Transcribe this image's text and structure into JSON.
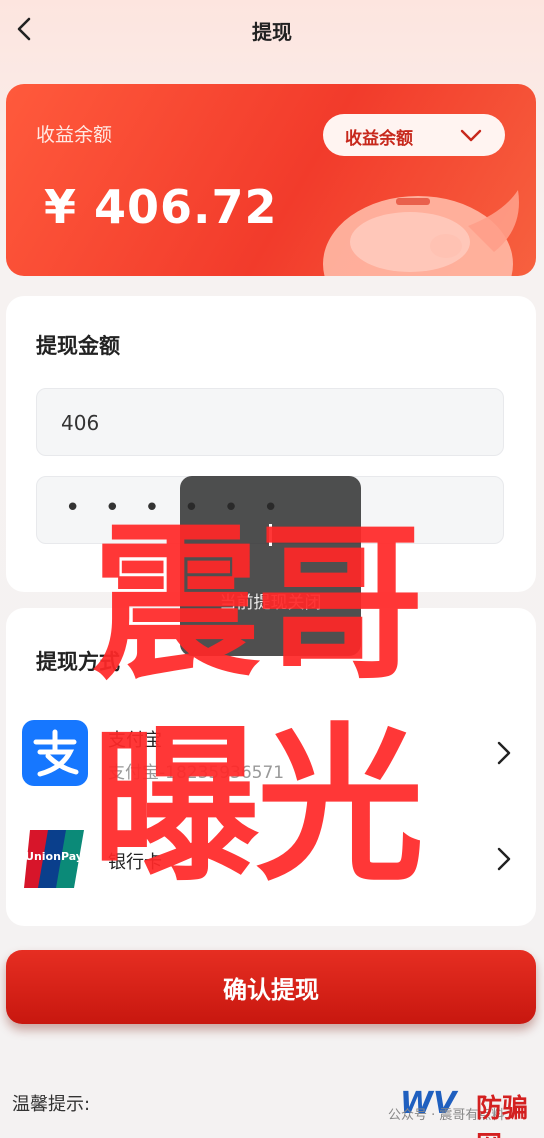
{
  "header": {
    "title": "提现"
  },
  "balance": {
    "label": "收益余额",
    "amount": "¥ 406.72",
    "selector_label": "收益余额"
  },
  "withdraw": {
    "section_title": "提现金额",
    "amount_value": "406",
    "password_dots": "• • • • • •"
  },
  "methods": {
    "section_title": "提现方式",
    "items": [
      {
        "name": "支付宝",
        "detail": "支付宝-18235936571"
      },
      {
        "name": "银行卡",
        "detail": ""
      }
    ]
  },
  "confirm_label": "确认提现",
  "tips_label": "温馨提示:",
  "toast": {
    "text": "当前提现关闭"
  },
  "overlay": {
    "line1": "震哥",
    "line2": "曝光"
  },
  "watermark": {
    "small": "公众号 · 震哥有点料",
    "brand": "防骗网"
  },
  "colors": {
    "accent": "#f23b2b",
    "button": "#d21e15",
    "alipay": "#1677ff",
    "unionpay": "#d7152a"
  }
}
